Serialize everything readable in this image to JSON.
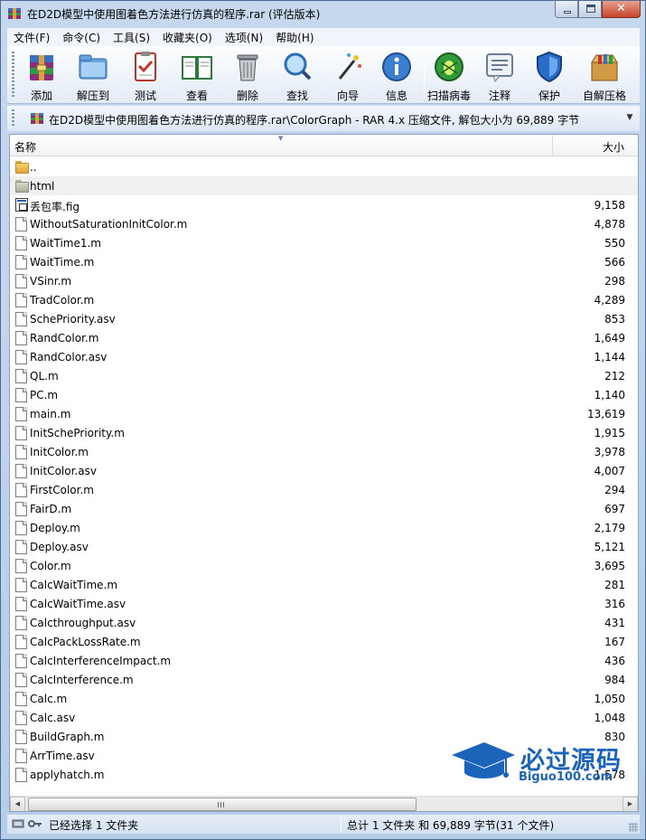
{
  "window": {
    "title": "在D2D模型中使用图着色方法进行仿真的程序.rar (评估版本)",
    "close_glyph": "✕"
  },
  "menu": [
    "文件(F)",
    "命令(C)",
    "工具(S)",
    "收藏夹(O)",
    "选项(N)",
    "帮助(H)"
  ],
  "toolbar": [
    {
      "label": "添加",
      "icon": "add-archive-icon"
    },
    {
      "label": "解压到",
      "icon": "extract-to-icon"
    },
    {
      "label": "测试",
      "icon": "test-icon"
    },
    {
      "label": "查看",
      "icon": "view-book-icon"
    },
    {
      "label": "删除",
      "icon": "delete-trash-icon"
    },
    {
      "label": "查找",
      "icon": "find-magnifier-icon"
    },
    {
      "label": "向导",
      "icon": "wizard-wand-icon"
    },
    {
      "label": "信息",
      "icon": "info-icon"
    },
    {
      "label": "扫描病毒",
      "icon": "virus-scan-icon"
    },
    {
      "label": "注释",
      "icon": "comment-icon"
    },
    {
      "label": "保护",
      "icon": "protect-shield-icon"
    },
    {
      "label": "自解压格",
      "icon": "sfx-box-icon"
    }
  ],
  "address": {
    "text": "在D2D模型中使用图着色方法进行仿真的程序.rar\\ColorGraph - RAR 4.x 压缩文件, 解包大小为 69,889 字节",
    "dropdown_glyph": "▼"
  },
  "list": {
    "col_name": "名称",
    "col_size": "大小",
    "sort_glyph": "▼",
    "items": [
      {
        "name": "..",
        "size": "",
        "type": "folder"
      },
      {
        "name": "html",
        "size": "",
        "type": "folder-grey"
      },
      {
        "name": "丢包率.fig",
        "size": "9,158",
        "type": "fig"
      },
      {
        "name": "WithoutSaturationInitColor.m",
        "size": "4,878",
        "type": "file"
      },
      {
        "name": "WaitTime1.m",
        "size": "550",
        "type": "file"
      },
      {
        "name": "WaitTime.m",
        "size": "566",
        "type": "file"
      },
      {
        "name": "VSinr.m",
        "size": "298",
        "type": "file"
      },
      {
        "name": "TradColor.m",
        "size": "4,289",
        "type": "file"
      },
      {
        "name": "SchePriority.asv",
        "size": "853",
        "type": "file"
      },
      {
        "name": "RandColor.m",
        "size": "1,649",
        "type": "file"
      },
      {
        "name": "RandColor.asv",
        "size": "1,144",
        "type": "file"
      },
      {
        "name": "QL.m",
        "size": "212",
        "type": "file"
      },
      {
        "name": "PC.m",
        "size": "1,140",
        "type": "file"
      },
      {
        "name": "main.m",
        "size": "13,619",
        "type": "file"
      },
      {
        "name": "InitSchePriority.m",
        "size": "1,915",
        "type": "file"
      },
      {
        "name": "InitColor.m",
        "size": "3,978",
        "type": "file"
      },
      {
        "name": "InitColor.asv",
        "size": "4,007",
        "type": "file"
      },
      {
        "name": "FirstColor.m",
        "size": "294",
        "type": "file"
      },
      {
        "name": "FairD.m",
        "size": "697",
        "type": "file"
      },
      {
        "name": "Deploy.m",
        "size": "2,179",
        "type": "file"
      },
      {
        "name": "Deploy.asv",
        "size": "5,121",
        "type": "file"
      },
      {
        "name": "Color.m",
        "size": "3,695",
        "type": "file"
      },
      {
        "name": "CalcWaitTime.m",
        "size": "281",
        "type": "file"
      },
      {
        "name": "CalcWaitTime.asv",
        "size": "316",
        "type": "file"
      },
      {
        "name": "Calcthroughput.asv",
        "size": "431",
        "type": "file"
      },
      {
        "name": "CalcPackLossRate.m",
        "size": "167",
        "type": "file"
      },
      {
        "name": "CalcInterferenceImpact.m",
        "size": "436",
        "type": "file"
      },
      {
        "name": "CalcInterference.m",
        "size": "984",
        "type": "file"
      },
      {
        "name": "Calc.m",
        "size": "1,050",
        "type": "file"
      },
      {
        "name": "Calc.asv",
        "size": "1,048",
        "type": "file"
      },
      {
        "name": "BuildGraph.m",
        "size": "830",
        "type": "file"
      },
      {
        "name": "ArrTime.asv",
        "size": "",
        "type": "file"
      },
      {
        "name": "applyhatch.m",
        "size": "1,578",
        "type": "file"
      }
    ]
  },
  "scrollbar": {
    "left_glyph": "◀",
    "right_glyph": "▶"
  },
  "watermark": {
    "title": "必过源码",
    "subtitle": "Biguo100.com"
  },
  "status": {
    "left": "已经选择 1 文件夹",
    "right": "总计 1 文件夹 和 69,889 字节(31 个文件)"
  },
  "colors": {
    "accent": "#1c64b9",
    "titlebar": "#c6d8ee",
    "close": "#c7442b"
  }
}
